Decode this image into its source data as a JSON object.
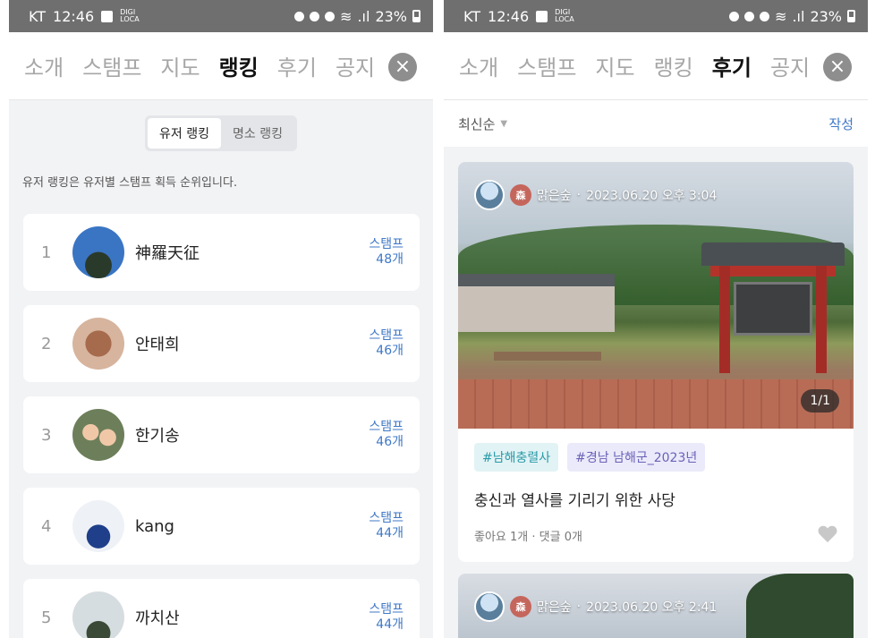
{
  "status_bar": {
    "carrier": "KT",
    "time": "12:46",
    "mini_label": "DIGI LOCA",
    "battery": "23%"
  },
  "tabs": [
    "소개",
    "스탬프",
    "지도",
    "랭킹",
    "후기",
    "공지"
  ],
  "left": {
    "active_tab_index": 3,
    "segment": [
      "유저 랭킹",
      "명소 랭킹"
    ],
    "description": "유저 랭킹은 유저별 스탬프 획득 순위입니다.",
    "rankings": [
      {
        "rank": "1",
        "name": "神羅天征",
        "stamp_label": "스탬프",
        "count": "48개",
        "avatar_color": "#3a6fb8"
      },
      {
        "rank": "2",
        "name": "안태희",
        "stamp_label": "스탬프",
        "count": "46개",
        "avatar_color": "#b06848"
      },
      {
        "rank": "3",
        "name": "한기송",
        "stamp_label": "스탬프",
        "count": "46개",
        "avatar_color": "#7c8f6a"
      },
      {
        "rank": "4",
        "name": "kang",
        "stamp_label": "스탬프",
        "count": "44개",
        "avatar_color": "#e8eef5"
      },
      {
        "rank": "5",
        "name": "까치산",
        "stamp_label": "스탬프",
        "count": "44개",
        "avatar_color": "#8aa08c"
      }
    ]
  },
  "right": {
    "active_tab_index": 4,
    "sort": "최신순",
    "write": "작성",
    "posts": [
      {
        "author_badge": "森",
        "author": "맑은숲",
        "date": "2023.06.20 오후 3:04",
        "page": "1/1",
        "tags": [
          "#남해충렬사",
          "#경남 남해군_2023년"
        ],
        "title": "충신과 열사를 기리기 위한 사당",
        "stats": "좋아요 1개 · 댓글 0개"
      },
      {
        "author_badge": "森",
        "author": "맑은숲",
        "date": "2023.06.20 오후 2:41"
      }
    ]
  }
}
